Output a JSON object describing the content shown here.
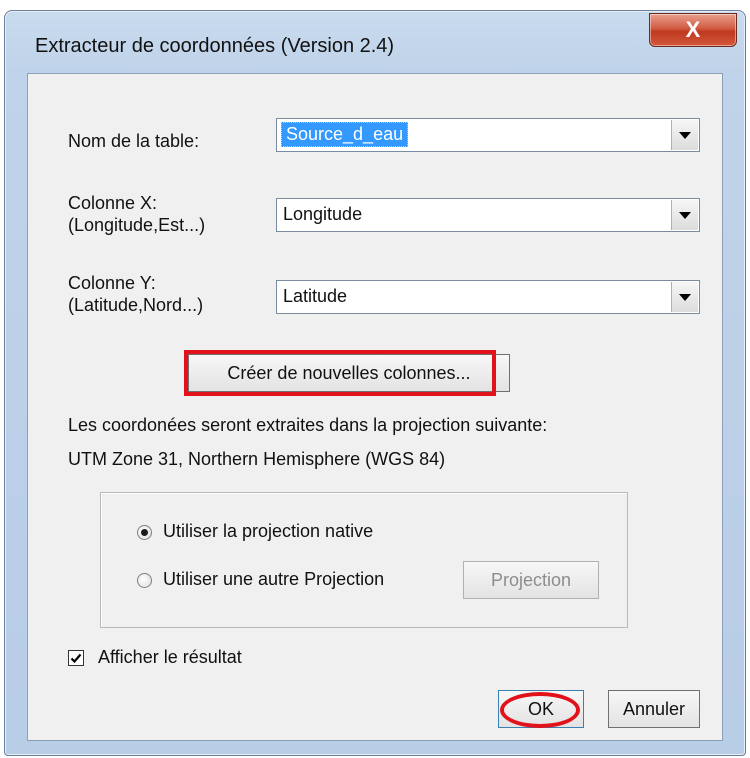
{
  "window": {
    "title": "Extracteur de coordonnées (Version 2.4)",
    "close_glyph": "X"
  },
  "form": {
    "table_label": "Nom de la table:",
    "table_value": "Source_d_eau",
    "colx_label_line1": "Colonne X:",
    "colx_label_line2": "(Longitude,Est...)",
    "colx_value": "Longitude",
    "coly_label_line1": "Colonne Y:",
    "coly_label_line2": "(Latitude,Nord...)",
    "coly_value": "Latitude",
    "create_columns_label": "Créer de nouvelles colonnes...",
    "info_line1": "Les coordonées seront extraites dans la projection suivante:",
    "info_line2": "UTM Zone 31, Northern Hemisphere (WGS 84)"
  },
  "projection_group": {
    "native_label": "Utiliser la projection native",
    "native_selected": true,
    "other_label": "Utiliser une autre Projection",
    "other_selected": false,
    "projection_button_label": "Projection"
  },
  "footer": {
    "show_result_label": "Afficher le résultat",
    "show_result_checked": true,
    "ok_label": "OK",
    "cancel_label": "Annuler"
  },
  "annotations": {
    "highlight_color": "#e2121a"
  },
  "icons": {
    "close": "close-icon",
    "dropdown": "chevron-down-icon",
    "check": "checkmark-icon"
  }
}
